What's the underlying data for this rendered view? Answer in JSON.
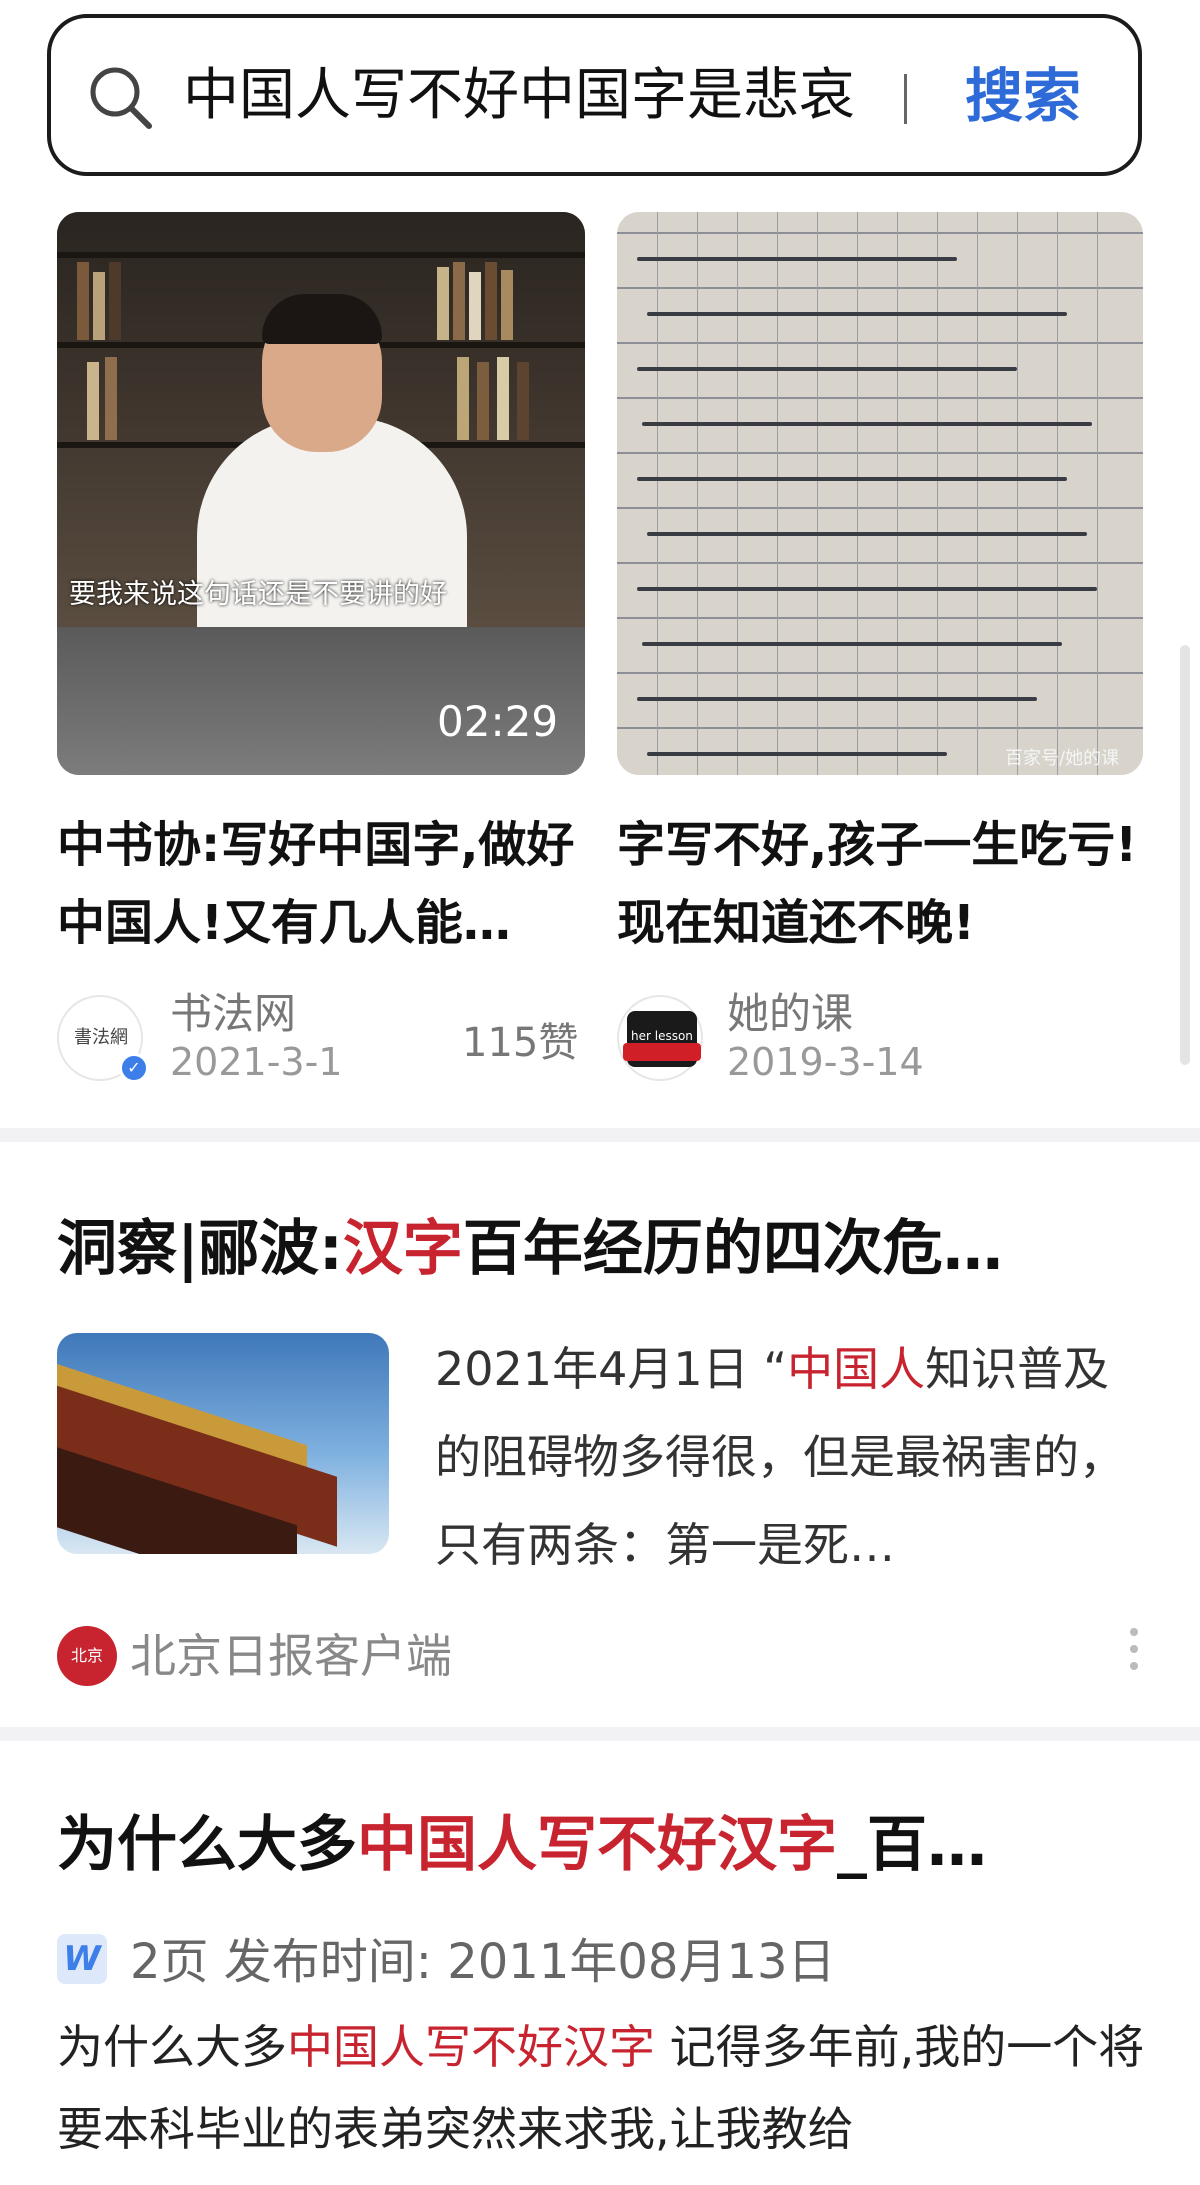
{
  "search": {
    "query": "中国人写不好中国字是悲哀",
    "button_label": "搜索"
  },
  "cards": [
    {
      "title": "中书协:写好中国字,做好中国人!又有几人能…",
      "subtitle_overlay": "要我来说这句话还是不要讲的好",
      "duration": "02:29",
      "author": "书法网",
      "avatar_text": "書法網",
      "date": "2021-3-1",
      "likes": "115赞"
    },
    {
      "title": "字写不好,孩子一生吃亏!现在知道还不晚!",
      "watermark": "百家号/她的课",
      "author": "她的课",
      "avatar_text": "her lesson",
      "date": "2019-3-14"
    }
  ],
  "article1": {
    "title_pre": "洞察|郦波:",
    "title_hl": "汉字",
    "title_post": "百年经历的四次危…",
    "snippet_pre": "2021年4月1日 “",
    "snippet_hl": "中国人",
    "snippet_post": "知识普及的阻碍物多得很，但是最祸害的，只有两条：第一是死…",
    "source": "北京日报客户端",
    "source_logo_text": "北京"
  },
  "article2": {
    "title_pre": "为什么大多",
    "title_hl": "中国人写不好汉字",
    "title_post": "_百…",
    "badge": "W",
    "meta": "2页  发布时间: 2011年08月13日",
    "body_pre": "为什么大多",
    "body_hl": "中国人写不好汉字",
    "body_post": " 记得多年前,我的一个将要本科毕业的表弟突然来求我,让我教给"
  },
  "colors": {
    "accent": "#2f6bd8",
    "highlight": "#c8242f",
    "verified": "#3d7ee8"
  }
}
